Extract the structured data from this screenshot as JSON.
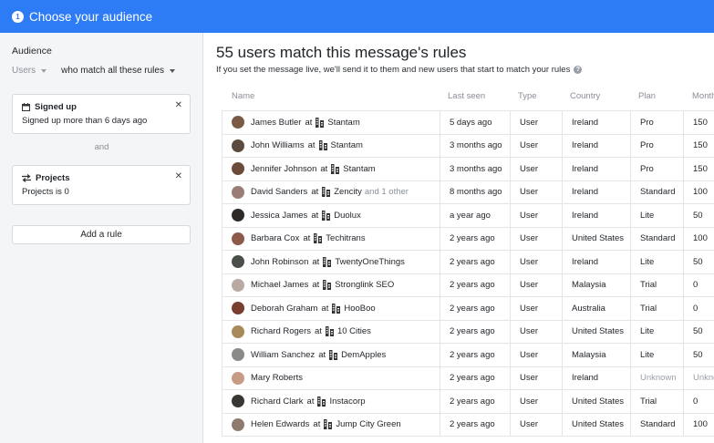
{
  "header": {
    "step": "1",
    "title": "Choose your audience"
  },
  "sidebar": {
    "audience_label": "Audience",
    "users_select": "Users",
    "match_select": "who match all these rules",
    "rules": [
      {
        "title": "Signed up",
        "desc": "Signed up more than 6 days ago",
        "icon": "calendar-icon"
      },
      {
        "title": "Projects",
        "desc": "Projects is 0",
        "icon": "arrows-icon"
      }
    ],
    "and_label": "and",
    "add_rule": "Add a rule"
  },
  "main": {
    "title": "55 users match this message's rules",
    "subtitle": "If you set the message live, we'll send it to them and new users that start to match your rules",
    "columns": [
      "Name",
      "Last seen",
      "Type",
      "Country",
      "Plan",
      "Monthly"
    ],
    "at": "at",
    "rows": [
      {
        "name": "James Butler",
        "company": "Stantam",
        "more": "",
        "last_seen": "5 days ago",
        "type": "User",
        "country": "Ireland",
        "plan": "Pro",
        "monthly": "150",
        "avatar": "#7a5a44"
      },
      {
        "name": "John Williams",
        "company": "Stantam",
        "more": "",
        "last_seen": "3 months ago",
        "type": "User",
        "country": "Ireland",
        "plan": "Pro",
        "monthly": "150",
        "avatar": "#5b4a40"
      },
      {
        "name": "Jennifer Johnson",
        "company": "Stantam",
        "more": "",
        "last_seen": "3 months ago",
        "type": "User",
        "country": "Ireland",
        "plan": "Pro",
        "monthly": "150",
        "avatar": "#6b4b3a"
      },
      {
        "name": "David Sanders",
        "company": "Zencity",
        "more": "and 1 other",
        "last_seen": "8 months ago",
        "type": "User",
        "country": "Ireland",
        "plan": "Standard",
        "monthly": "100",
        "avatar": "#9a7d74"
      },
      {
        "name": "Jessica James",
        "company": "Duolux",
        "more": "",
        "last_seen": "a year ago",
        "type": "User",
        "country": "Ireland",
        "plan": "Lite",
        "monthly": "50",
        "avatar": "#2e2a28"
      },
      {
        "name": "Barbara Cox",
        "company": "Techitrans",
        "more": "",
        "last_seen": "2 years ago",
        "type": "User",
        "country": "United States",
        "plan": "Standard",
        "monthly": "100",
        "avatar": "#8d5a4a"
      },
      {
        "name": "John Robinson",
        "company": "TwentyOneThings",
        "more": "",
        "last_seen": "2 years ago",
        "type": "User",
        "country": "Ireland",
        "plan": "Lite",
        "monthly": "50",
        "avatar": "#4a4f4a"
      },
      {
        "name": "Michael James",
        "company": "Stronglink SEO",
        "more": "",
        "last_seen": "2 years ago",
        "type": "User",
        "country": "Malaysia",
        "plan": "Trial",
        "monthly": "0",
        "avatar": "#b9aba4"
      },
      {
        "name": "Deborah Graham",
        "company": "HooBoo",
        "more": "",
        "last_seen": "2 years ago",
        "type": "User",
        "country": "Australia",
        "plan": "Trial",
        "monthly": "0",
        "avatar": "#7a3e2e"
      },
      {
        "name": "Richard Rogers",
        "company": "10 Cities",
        "more": "",
        "last_seen": "2 years ago",
        "type": "User",
        "country": "United States",
        "plan": "Lite",
        "monthly": "50",
        "avatar": "#a88a5a"
      },
      {
        "name": "William Sanchez",
        "company": "DemApples",
        "more": "",
        "last_seen": "2 years ago",
        "type": "User",
        "country": "Malaysia",
        "plan": "Lite",
        "monthly": "50",
        "avatar": "#8a8a88"
      },
      {
        "name": "Mary Roberts",
        "company": "",
        "more": "",
        "last_seen": "2 years ago",
        "type": "User",
        "country": "Ireland",
        "plan": "Unknown",
        "monthly": "Unknown",
        "avatar": "#c79a86"
      },
      {
        "name": "Richard Clark",
        "company": "Instacorp",
        "more": "",
        "last_seen": "2 years ago",
        "type": "User",
        "country": "United States",
        "plan": "Trial",
        "monthly": "0",
        "avatar": "#3a3634"
      },
      {
        "name": "Helen Edwards",
        "company": "Jump City Green",
        "more": "",
        "last_seen": "2 years ago",
        "type": "User",
        "country": "United States",
        "plan": "Standard",
        "monthly": "100",
        "avatar": "#8f7a70"
      }
    ]
  },
  "colors": {
    "accent": "#2e7bf6",
    "sidebar_bg": "#f4f5f7",
    "muted_text": "#8a8f98"
  }
}
